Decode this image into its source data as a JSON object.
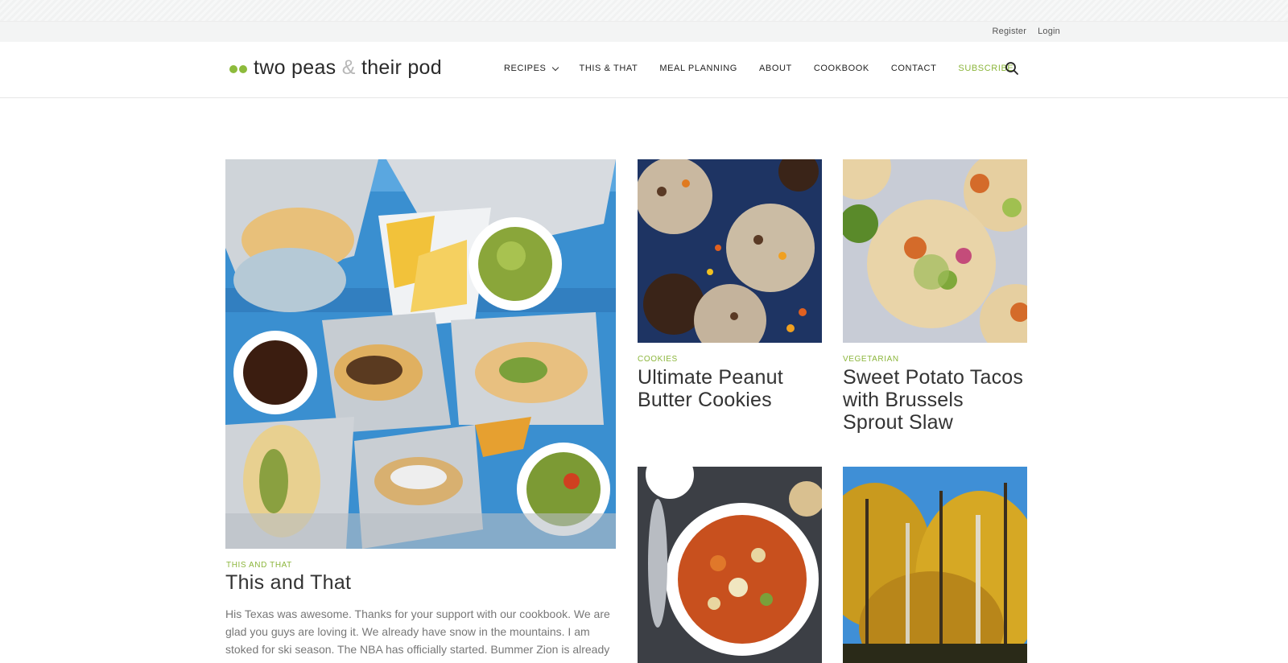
{
  "utility": {
    "register": "Register",
    "login": "Login"
  },
  "brand": {
    "part1": "two peas ",
    "amp": "&",
    "part2": " their pod",
    "dot_color": "#8dbb3c"
  },
  "nav": {
    "items": [
      "RECIPES",
      "THIS & THAT",
      "MEAL PLANNING",
      "ABOUT",
      "COOKBOOK",
      "CONTACT"
    ],
    "subscribe": "SUBSCRIBE",
    "accent": "#8cb63c"
  },
  "feature": {
    "category": "THIS AND THAT",
    "title": "This and That",
    "excerpt": "His Texas was awesome. Thanks for your support with our cookbook. We are glad you guys are loving it. We already have snow in the mountains. I am stoked for ski season. The NBA has officially started. Bummer Zion is already injured, he is so fun"
  },
  "cards": [
    {
      "category": "COOKIES",
      "title": "Ultimate Peanut Butter Cookies"
    },
    {
      "category": "VEGETARIAN",
      "title": "Sweet Potato Tacos with Brussels Sprout Slaw"
    }
  ]
}
